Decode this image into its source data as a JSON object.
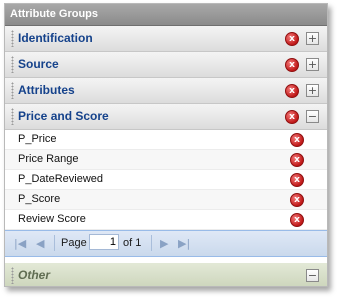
{
  "panel": {
    "title": "Attribute Groups"
  },
  "groups": [
    {
      "title": "Identification",
      "toggle": "+"
    },
    {
      "title": "Source",
      "toggle": "+"
    },
    {
      "title": "Attributes",
      "toggle": "+"
    },
    {
      "title": "Price and Score",
      "toggle": "−"
    }
  ],
  "attributes": [
    "P_Price",
    "Price Range",
    "P_DateReviewed",
    "P_Score",
    "Review Score"
  ],
  "pager": {
    "page_label": "Page",
    "page_value": "1",
    "of_label": "of 1",
    "first_icon": "first-page-icon",
    "prev_icon": "prev-page-icon",
    "next_icon": "next-page-icon",
    "last_icon": "last-page-icon"
  },
  "other_group": {
    "title": "Other",
    "toggle": "−"
  },
  "icons": {
    "delete": "x",
    "delete_color": "#c01818",
    "title_color": "#15428b"
  }
}
